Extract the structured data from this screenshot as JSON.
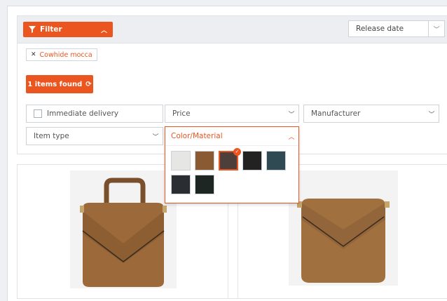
{
  "filter": {
    "button_label": "Filter",
    "sort_value": "Release date",
    "active_chip": "Cowhide mocca",
    "found_label": "1 items found",
    "delivery_label": "Immediate delivery",
    "price_label": "Price",
    "manufacturer_label": "Manufacturer",
    "item_type_label": "Item type",
    "color_label": "Color/Material"
  },
  "swatches": [
    {
      "name": "white",
      "color": "#e6e6e4",
      "selected": false
    },
    {
      "name": "brown",
      "color": "#8a5a32",
      "selected": false
    },
    {
      "name": "mocca",
      "color": "#4e3f3a",
      "selected": true
    },
    {
      "name": "black",
      "color": "#222223",
      "selected": false
    },
    {
      "name": "petrol",
      "color": "#2f4a52",
      "selected": false
    },
    {
      "name": "dark-grey",
      "color": "#2a2d31",
      "selected": false
    },
    {
      "name": "dark-green",
      "color": "#1e2623",
      "selected": false
    }
  ],
  "colors": {
    "accent": "#ea5520",
    "bag": "#9c6a3a"
  }
}
